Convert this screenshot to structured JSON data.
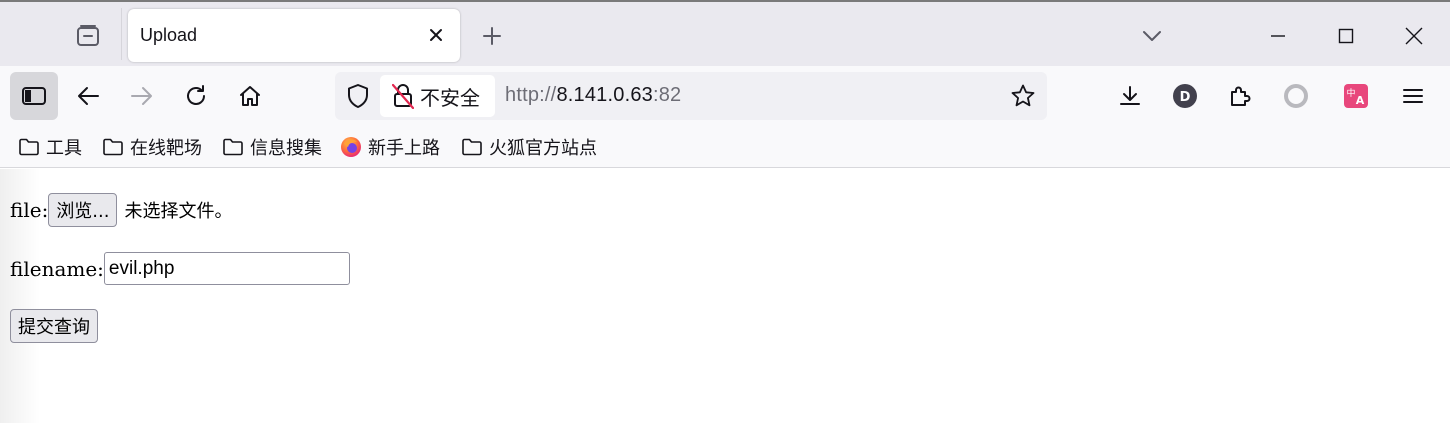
{
  "tab": {
    "title": "Upload"
  },
  "urlbar": {
    "insecure_label": "不安全",
    "url_scheme": "http://",
    "url_host": "8.141.0.63",
    "url_port": ":82"
  },
  "toolbar": {
    "account_initial": "D"
  },
  "bookmarks": [
    {
      "label": "工具",
      "icon": "folder-icon"
    },
    {
      "label": "在线靶场",
      "icon": "folder-icon"
    },
    {
      "label": "信息搜集",
      "icon": "folder-icon"
    },
    {
      "label": "新手上路",
      "icon": "firefox-icon"
    },
    {
      "label": "火狐官方站点",
      "icon": "folder-icon"
    }
  ],
  "form": {
    "file_label": "file:",
    "browse_button": "浏览...",
    "no_file_text": "未选择文件。",
    "filename_label": "filename:",
    "filename_value": "evil.php",
    "submit_button": "提交查询"
  },
  "colors": {
    "tabstrip_bg": "#eae9ef",
    "navbar_bg": "#f9f9fb",
    "translate_icon_bg": "#e8477c",
    "firefox_orange": "#ff7139"
  }
}
